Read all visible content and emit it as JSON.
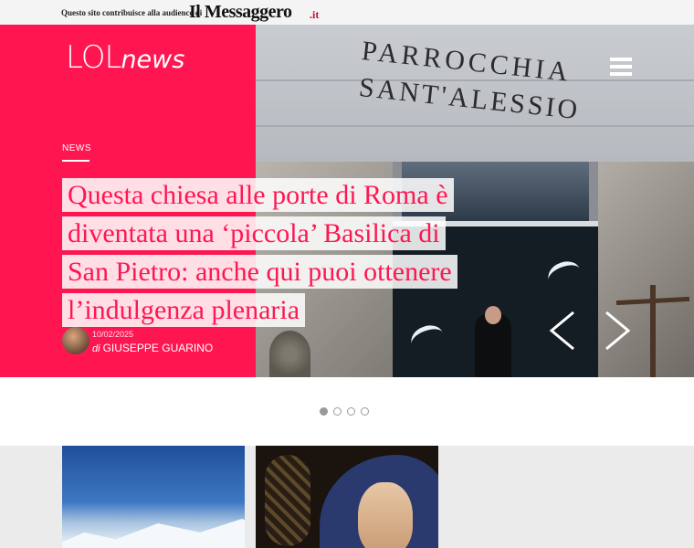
{
  "topbar": {
    "contribution_text": "Questo sito contribuisce alla audience di",
    "brand_name": "Il Messaggero",
    "brand_tld": ".it"
  },
  "site": {
    "logo_lol": "LOL",
    "logo_news": "news"
  },
  "hero": {
    "photo_sign_line1": "PARROCCHIA",
    "photo_sign_line2": "SANT'ALESSIO",
    "category": "NEWS",
    "headline": "Questa chiesa alle porte di Roma è diventata una ‘piccola’ Basilica di San Pietro: anche qui puoi ottenere l’indulgenza plenaria",
    "date": "10/02/2025",
    "byline_prefix": "di",
    "author": "GIUSEPPE GUARINO"
  },
  "slider": {
    "total": 4,
    "active_index": 0
  },
  "colors": {
    "accent": "#ff1651",
    "topbar_bg": "#f4f4f4",
    "strip_bg": "#ebebeb"
  },
  "icons": {
    "menu": "hamburger-menu-icon",
    "prev": "chevron-left-icon",
    "next": "chevron-right-icon"
  }
}
